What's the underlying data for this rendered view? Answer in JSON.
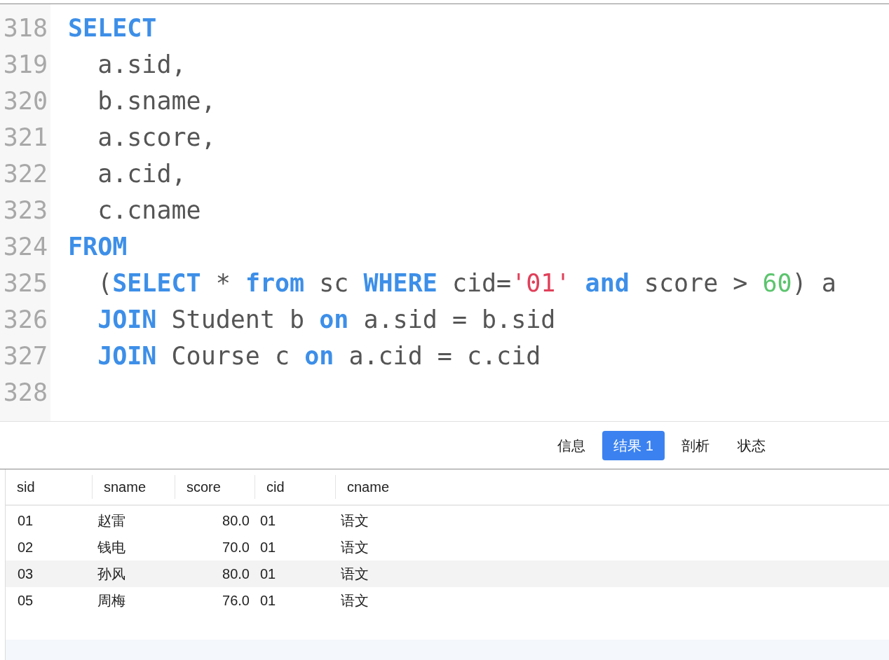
{
  "editor": {
    "lines": [
      {
        "number": "318",
        "tokens": [
          {
            "kind": "keyword",
            "text": "SELECT"
          }
        ]
      },
      {
        "number": "319",
        "tokens": [
          {
            "kind": "plain",
            "text": "  a.sid,"
          }
        ]
      },
      {
        "number": "320",
        "tokens": [
          {
            "kind": "plain",
            "text": "  b.sname,"
          }
        ]
      },
      {
        "number": "321",
        "tokens": [
          {
            "kind": "plain",
            "text": "  a.score,"
          }
        ]
      },
      {
        "number": "322",
        "tokens": [
          {
            "kind": "plain",
            "text": "  a.cid,"
          }
        ]
      },
      {
        "number": "323",
        "tokens": [
          {
            "kind": "plain",
            "text": "  c.cname"
          }
        ]
      },
      {
        "number": "324",
        "tokens": [
          {
            "kind": "keyword",
            "text": "FROM"
          }
        ]
      },
      {
        "number": "325",
        "tokens": [
          {
            "kind": "plain",
            "text": "  ("
          },
          {
            "kind": "keyword",
            "text": "SELECT"
          },
          {
            "kind": "plain",
            "text": " * "
          },
          {
            "kind": "keyword",
            "text": "from"
          },
          {
            "kind": "plain",
            "text": " sc "
          },
          {
            "kind": "keyword",
            "text": "WHERE"
          },
          {
            "kind": "plain",
            "text": " cid="
          },
          {
            "kind": "string",
            "text": "'01'"
          },
          {
            "kind": "keyword",
            "text": " and"
          },
          {
            "kind": "plain",
            "text": " score > "
          },
          {
            "kind": "number",
            "text": "60"
          },
          {
            "kind": "plain",
            "text": ") a"
          }
        ]
      },
      {
        "number": "326",
        "tokens": [
          {
            "kind": "keyword",
            "text": "  JOIN"
          },
          {
            "kind": "plain",
            "text": " Student b "
          },
          {
            "kind": "keyword",
            "text": "on"
          },
          {
            "kind": "plain",
            "text": " a.sid = b.sid"
          }
        ]
      },
      {
        "number": "327",
        "tokens": [
          {
            "kind": "keyword",
            "text": "  JOIN"
          },
          {
            "kind": "plain",
            "text": " Course c "
          },
          {
            "kind": "keyword",
            "text": "on"
          },
          {
            "kind": "plain",
            "text": " a.cid = c.cid"
          }
        ]
      },
      {
        "number": "328"
      }
    ]
  },
  "tabs": [
    {
      "label": "信息",
      "selected": false
    },
    {
      "label": "结果 1",
      "selected": true
    },
    {
      "label": "剖析",
      "selected": false
    },
    {
      "label": "状态",
      "selected": false
    }
  ],
  "table": {
    "columns": [
      {
        "label": "sid",
        "kind": "text"
      },
      {
        "label": "sname",
        "kind": "text"
      },
      {
        "label": "score",
        "kind": "number"
      },
      {
        "label": "cid",
        "kind": "text"
      },
      {
        "label": "cname",
        "kind": "text"
      }
    ],
    "rows": [
      {
        "highlighted": false,
        "cells": [
          "01",
          "赵雷",
          "80.0",
          "01",
          "语文"
        ]
      },
      {
        "highlighted": false,
        "cells": [
          "02",
          "钱电",
          "70.0",
          "01",
          "语文"
        ]
      },
      {
        "highlighted": true,
        "cells": [
          "03",
          "孙风",
          "80.0",
          "01",
          "语文"
        ]
      },
      {
        "highlighted": false,
        "cells": [
          "05",
          "周梅",
          "76.0",
          "01",
          "语文"
        ]
      }
    ]
  }
}
